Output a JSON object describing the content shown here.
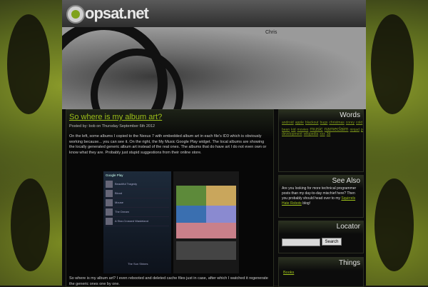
{
  "site": {
    "logo_text": "opsat.net",
    "banner_tag": "Chris"
  },
  "post": {
    "title": "So where is my album art?",
    "meta": "Posted by: bob on Thursday September 6th 2012",
    "body": "On the left, some albums I copied to the Nexus 7 with embedded album art in each file's ID3 which is obviously working because... you can see it. On the right, the My Music Google Play widget. The local albums are showing the locally generated generic album art instead of the real ones. The albums that do have art I do not even own or know what they are. Probably just stupid suggestions from their online store.",
    "footer": "So where is my album art? I even rebooted and deleted cache files just in case, after which I watched it regenerate the generic ones one by one.",
    "screenshot": {
      "header": "Google Play",
      "albums": [
        "Beautiful Tragedy",
        "Blood",
        "Mouse",
        "The Dream",
        "A Star-Crossed Wasteland"
      ],
      "footer_item": "The Sun Shines"
    }
  },
  "widgets": {
    "words": {
      "title": "Words",
      "tags": [
        "android",
        "apple",
        "blackout",
        "bugs",
        "christmas",
        "corey",
        "cold",
        "demo",
        "dying",
        "dollars",
        "domains",
        "fireplace",
        "geek",
        "home",
        "inkoff",
        "jelly bean",
        "kid",
        "movies",
        "music",
        "nameclaim",
        "ninjad",
        "performance",
        "photobucket",
        "php",
        "programming",
        "rejected",
        "sops",
        "sunshine",
        "texas",
        "tumblr",
        "turkey",
        "twitter",
        "web development",
        "wikipedia",
        "xxx",
        "3d"
      ],
      "big_tags": [
        "programming",
        "texas"
      ],
      "mid_tags": [
        "music",
        "nameclaim"
      ]
    },
    "see_also": {
      "title": "See Also",
      "text": "Are you looking for more technical programmer posts than my day-to-day mischief here? Then you probably should head over to my",
      "link": "Squirrels Hate Robots",
      "suffix": "blog!"
    },
    "locator": {
      "title": "Locator",
      "search_placeholder": "",
      "search_button": "Search"
    },
    "things": {
      "title": "Things",
      "link": "Books"
    }
  },
  "colors": {
    "accent": "#9ec21a",
    "background": "#0b0b0b"
  }
}
